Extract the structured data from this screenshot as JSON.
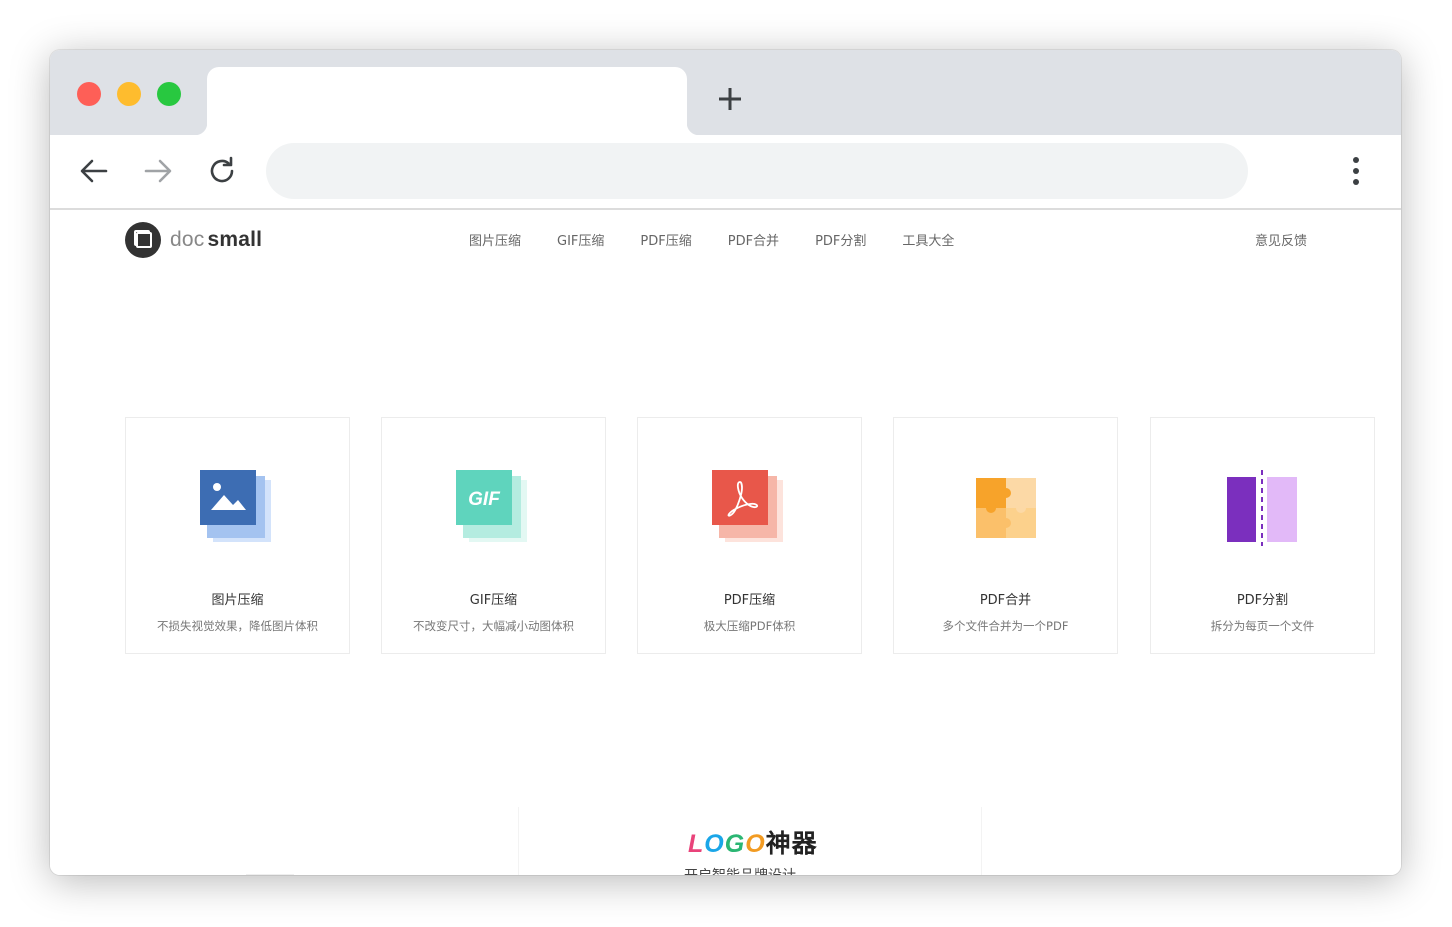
{
  "browser": {
    "tab_title": "",
    "address": "",
    "colors": {
      "close": "#fe5f57",
      "minimize": "#febc2e",
      "zoom": "#28c840",
      "tabbar": "#dee1e6"
    }
  },
  "site": {
    "logo": {
      "doc": "doc",
      "small": "small"
    },
    "nav": [
      "图片压缩",
      "GIF压缩",
      "PDF压缩",
      "PDF合并",
      "PDF分割",
      "工具大全"
    ],
    "feedback": "意见反馈"
  },
  "cards": [
    {
      "title": "图片压缩",
      "desc": "不损失视觉效果，降低图片体积",
      "icon": "image-compress-icon",
      "color": "#3d6db3"
    },
    {
      "title": "GIF压缩",
      "desc": "不改变尺寸，大幅减小动图体积",
      "icon": "gif-compress-icon",
      "color": "#5fd4bd"
    },
    {
      "title": "PDF压缩",
      "desc": "极大压缩PDF体积",
      "icon": "pdf-compress-icon",
      "color": "#e8574a"
    },
    {
      "title": "PDF合并",
      "desc": "多个文件合并为一个PDF",
      "icon": "puzzle-merge-icon",
      "color": "#f7a32a"
    },
    {
      "title": "PDF分割",
      "desc": "拆分为每页一个文件",
      "icon": "split-icon",
      "color": "#7b2fbe"
    }
  ],
  "promo": {
    "logo_letters": [
      "L",
      "O",
      "G",
      "O"
    ],
    "logo_cn": "神器",
    "subtitle": "开启智能品牌设计"
  }
}
